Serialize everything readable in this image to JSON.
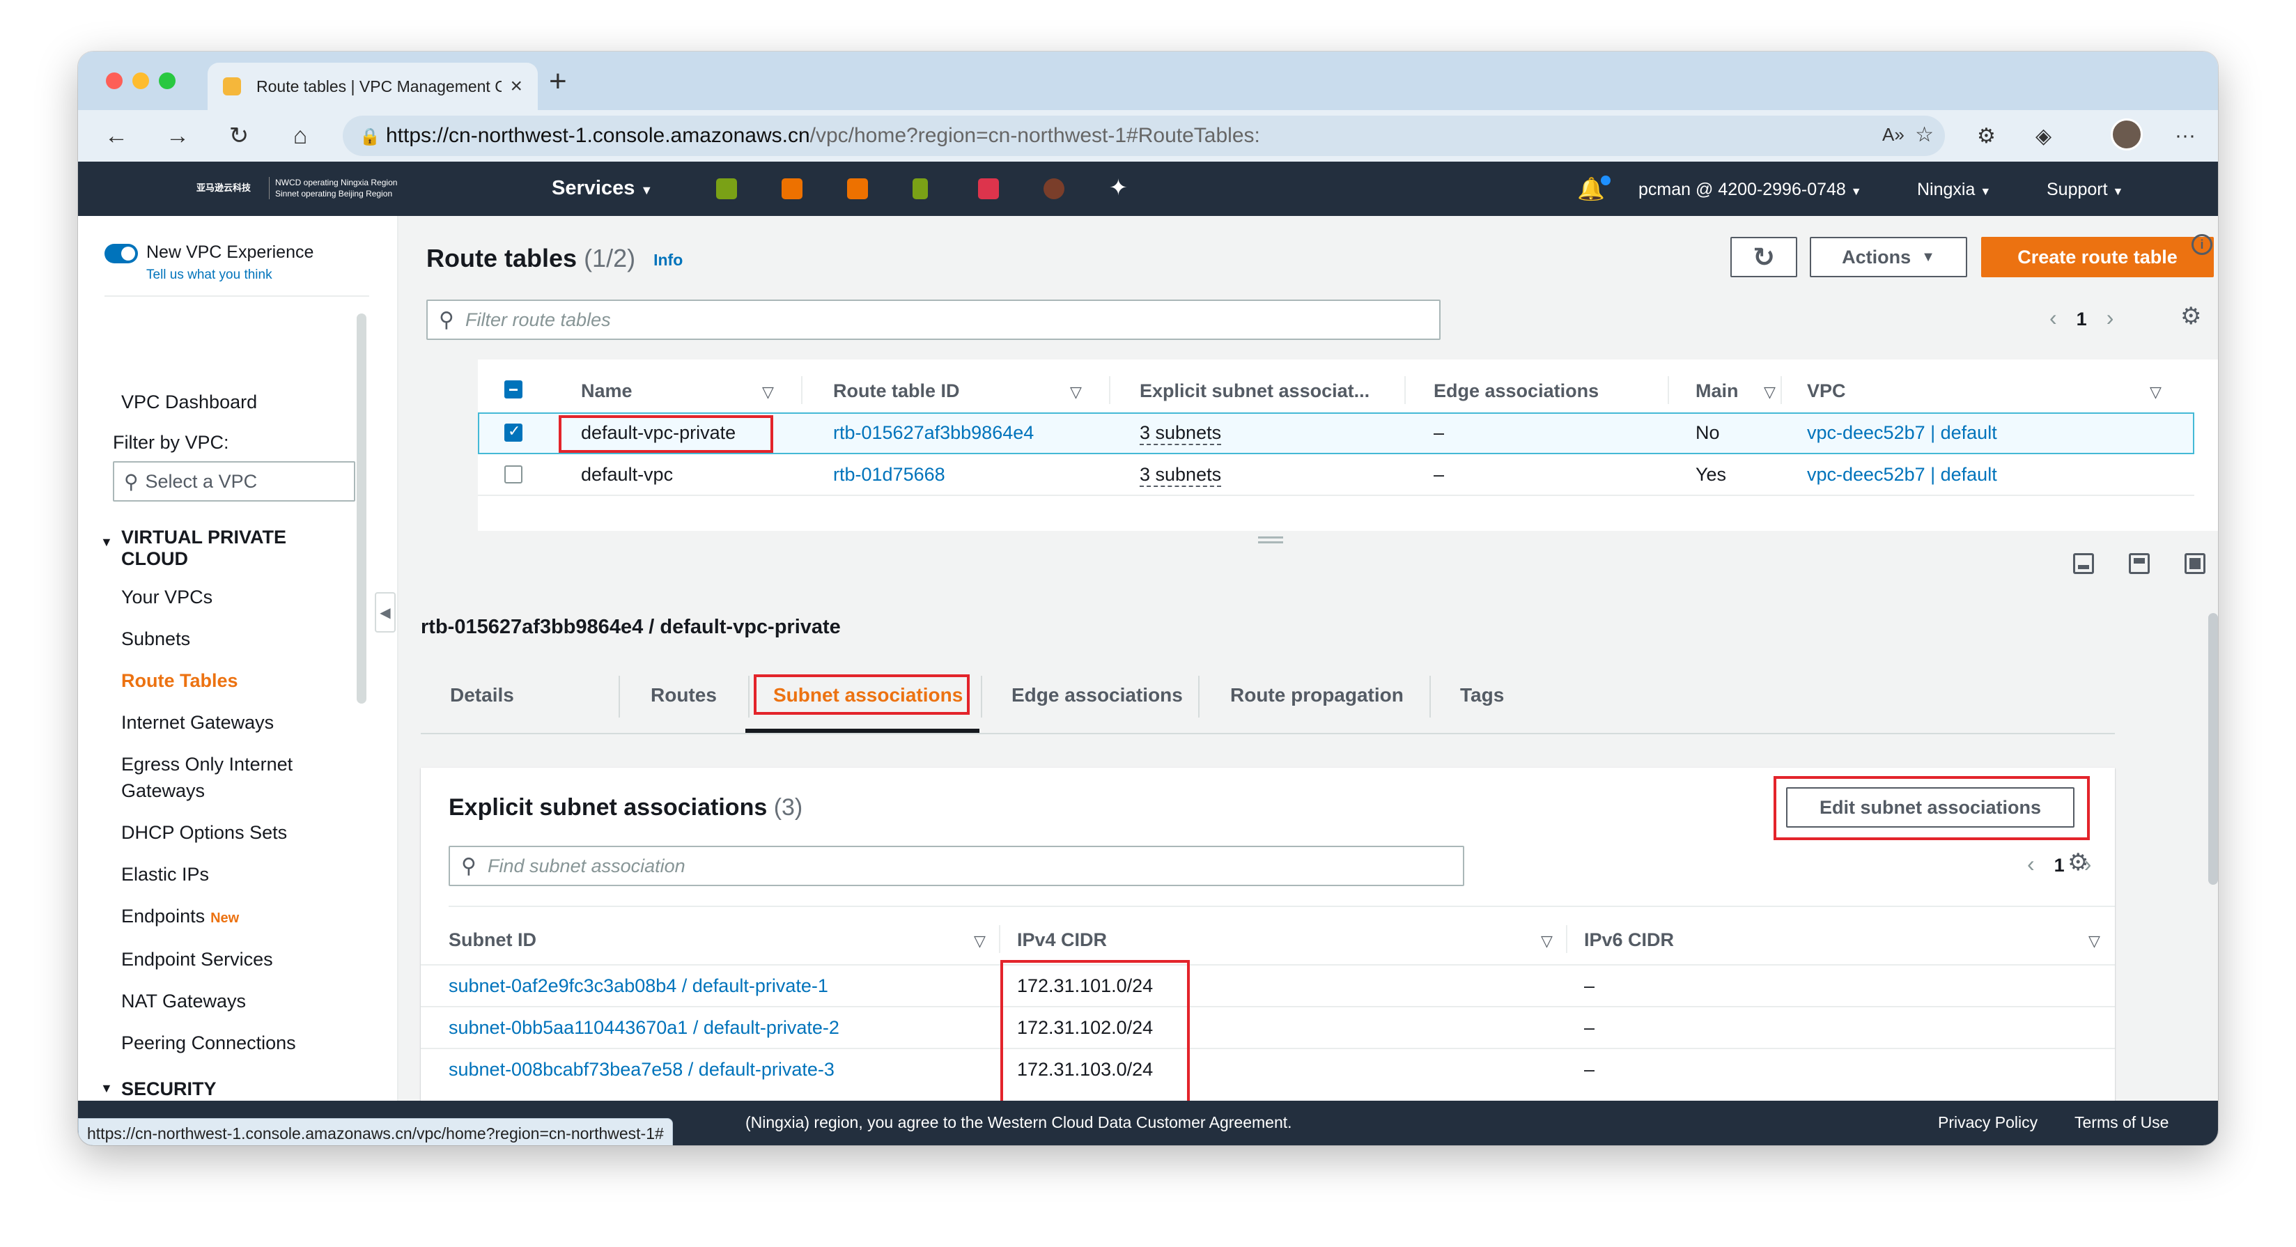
{
  "browser": {
    "tab_title": "Route tables | VPC Management Console",
    "url_host": "https://cn-northwest-1.console.amazonaws.cn",
    "url_path": "/vpc/home?region=cn-northwest-1#RouteTables:",
    "status_url": "https://cn-northwest-1.console.amazonaws.cn/vpc/home?region=cn-northwest-1#"
  },
  "aws_header": {
    "logo_cn": "亚马逊云科技",
    "logo_line1": "NWCD operating Ningxia Region",
    "logo_line2": "Sinnet operating Beijing Region",
    "services": "Services",
    "account": "pcman @ 4200-2996-0748",
    "region": "Ningxia",
    "support": "Support"
  },
  "sidebar": {
    "new_vpc_experience": "New VPC Experience",
    "tell_us": "Tell us what you think",
    "dashboard": "VPC Dashboard",
    "filter_label": "Filter by VPC:",
    "vpc_select_placeholder": "Select a VPC",
    "section_vpc_line1": "VIRTUAL PRIVATE",
    "section_vpc_line2": "CLOUD",
    "items": [
      "Your VPCs",
      "Subnets",
      "Route Tables",
      "Internet Gateways",
      "Egress Only Internet",
      "Gateways",
      "DHCP Options Sets",
      "Elastic IPs",
      "Endpoints",
      "Endpoint Services",
      "NAT Gateways",
      "Peering Connections"
    ],
    "new_badge": "New",
    "section_security": "SECURITY"
  },
  "route_tables": {
    "title": "Route tables",
    "count": "(1/2)",
    "info": "Info",
    "actions": "Actions",
    "create": "Create route table",
    "filter_placeholder": "Filter route tables",
    "page": "1",
    "columns": [
      "Name",
      "Route table ID",
      "Explicit subnet associat...",
      "Edge associations",
      "Main",
      "VPC"
    ],
    "rows": [
      {
        "name": "default-vpc-private",
        "id": "rtb-015627af3bb9864e4",
        "explicit": "3 subnets",
        "edge": "–",
        "main": "No",
        "vpc": "vpc-deec52b7 | default",
        "selected": true
      },
      {
        "name": "default-vpc",
        "id": "rtb-01d75668",
        "explicit": "3 subnets",
        "edge": "–",
        "main": "Yes",
        "vpc": "vpc-deec52b7 | default",
        "selected": false
      }
    ]
  },
  "detail": {
    "title": "rtb-015627af3bb9864e4 / default-vpc-private",
    "tabs": [
      "Details",
      "Routes",
      "Subnet associations",
      "Edge associations",
      "Route propagation",
      "Tags"
    ],
    "selected_tab": "Subnet associations",
    "section_title": "Explicit subnet associations",
    "section_count": "(3)",
    "edit_button": "Edit subnet associations",
    "find_placeholder": "Find subnet association",
    "page": "1",
    "columns": [
      "Subnet ID",
      "IPv4 CIDR",
      "IPv6 CIDR"
    ],
    "rows": [
      {
        "subnet": "subnet-0af2e9fc3c3ab08b4 / default-private-1",
        "ipv4": "172.31.101.0/24",
        "ipv6": "–"
      },
      {
        "subnet": "subnet-0bb5aa110443670a1 / default-private-2",
        "ipv4": "172.31.102.0/24",
        "ipv6": "–"
      },
      {
        "subnet": "subnet-008bcabf73bea7e58 / default-private-3",
        "ipv4": "172.31.103.0/24",
        "ipv6": "–"
      }
    ]
  },
  "footer": {
    "text_pre": "(Ningxia) region, you agree to the",
    "agreement": "Western Cloud Data Customer Agreement",
    "text_post": ".",
    "privacy": "Privacy Policy",
    "terms": "Terms of Use"
  },
  "colors": {
    "aws_orange": "#ec7211",
    "link_blue": "#0073bb",
    "header_dark": "#232f3e",
    "highlight_red": "#e3242b"
  }
}
